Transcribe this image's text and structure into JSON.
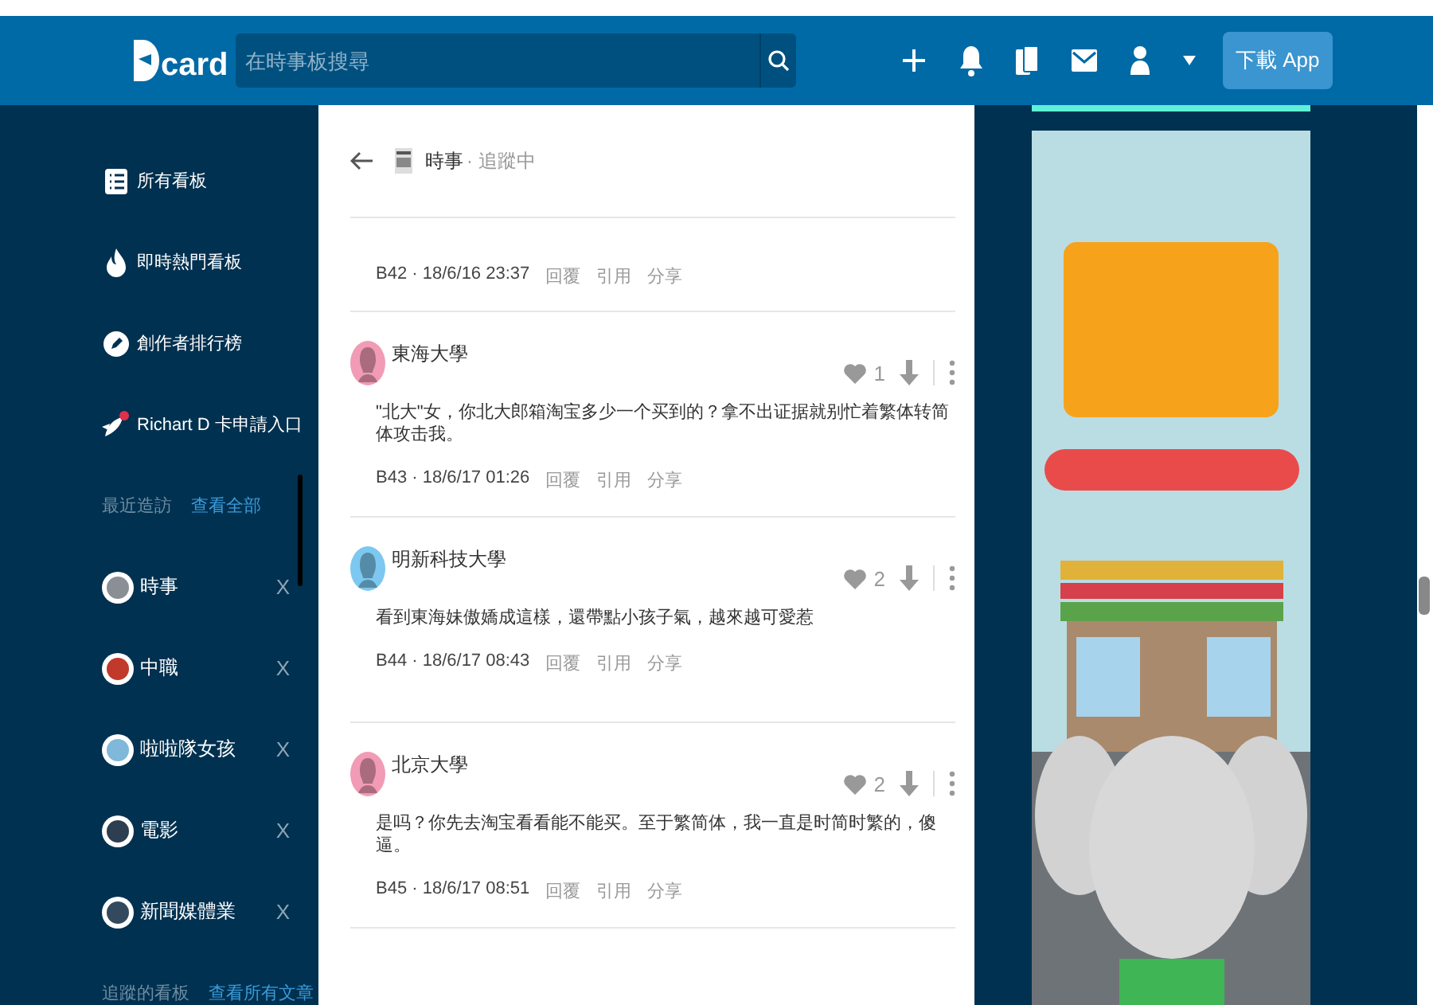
{
  "header": {
    "logo": "card",
    "search": {
      "placeholder": "在時事板搜尋"
    },
    "download_button": "下載 App"
  },
  "sidebar": {
    "nav": [
      {
        "label": "所有看板"
      },
      {
        "label": "即時熱門看板"
      },
      {
        "label": "創作者排行榜"
      },
      {
        "label": "Richart D 卡申請入口"
      }
    ],
    "recent": {
      "title": "最近造訪",
      "link": "查看全部",
      "items": [
        {
          "label": "時事",
          "close": "X",
          "color": "#8a8f96"
        },
        {
          "label": "中職",
          "close": "X",
          "color": "#c0392b"
        },
        {
          "label": "啦啦隊女孩",
          "close": "X",
          "color": "#7fb8d8"
        },
        {
          "label": "電影",
          "close": "X",
          "color": "#2c3e50"
        },
        {
          "label": "新聞媒體業",
          "close": "X",
          "color": "#34495e"
        }
      ]
    },
    "followed": {
      "title": "追蹤的看板",
      "link": "查看所有文章"
    }
  },
  "board": {
    "name": "時事",
    "status": "· 追蹤中"
  },
  "comments": [
    {
      "meta": "B42 · 18/6/16 23:37",
      "actions": [
        "回覆",
        "引用",
        "分享"
      ]
    },
    {
      "author": "東海大學",
      "color": "#f29bb6",
      "text": "\"北大\"女，你北大郎箱淘宝多少一个买到的？拿不出证据就别忙着繁体转简体攻击我。",
      "likes": "1",
      "meta": "B43 · 18/6/17 01:26",
      "actions": [
        "回覆",
        "引用",
        "分享"
      ]
    },
    {
      "author": "明新科技大學",
      "color": "#7cc8f0",
      "text": "看到東海妹傲嬌成這樣，還帶點小孩子氣，越來越可愛惹",
      "likes": "2",
      "meta": "B44 · 18/6/17 08:43",
      "actions": [
        "回覆",
        "引用",
        "分享"
      ]
    },
    {
      "author": "北京大學",
      "color": "#f29bb6",
      "text": "是吗？你先去淘宝看看能不能买。至于繁简体，我一直是时简时繁的，傻逼。",
      "likes": "2",
      "meta": "B45 · 18/6/17 08:51",
      "actions": [
        "回覆",
        "引用",
        "分享"
      ]
    }
  ]
}
